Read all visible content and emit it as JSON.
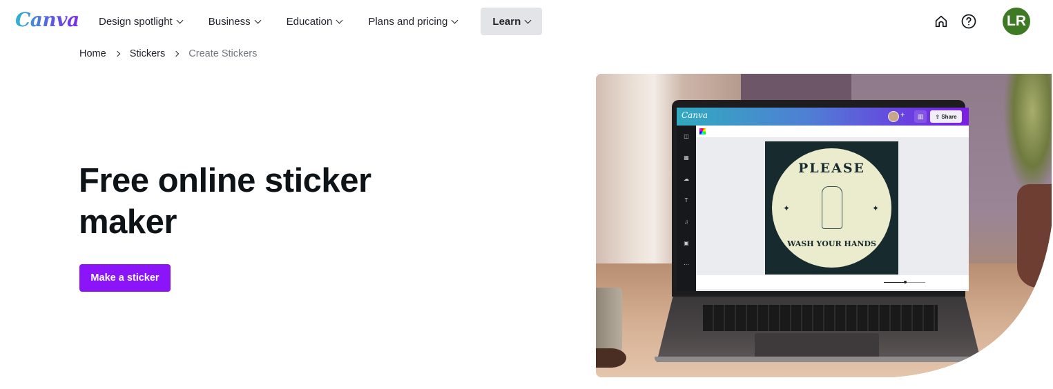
{
  "nav": {
    "logo": "Canva",
    "items": [
      {
        "label": "Design spotlight",
        "has_dropdown": true,
        "active": false
      },
      {
        "label": "Business",
        "has_dropdown": true,
        "active": false
      },
      {
        "label": "Education",
        "has_dropdown": true,
        "active": false
      },
      {
        "label": "Plans and pricing",
        "has_dropdown": true,
        "active": false
      },
      {
        "label": "Learn",
        "has_dropdown": true,
        "active": true
      }
    ],
    "icons": {
      "home": "home-icon",
      "help": "help-circle-icon"
    },
    "avatar_initials": "LR",
    "avatar_color": "#3d7a23"
  },
  "breadcrumb": {
    "items": [
      "Home",
      "Stickers"
    ],
    "current": "Create Stickers"
  },
  "hero": {
    "title_line1": "Free online sticker",
    "title_line2": "maker",
    "cta_label": "Make a sticker",
    "cta_color": "#8b14f8"
  },
  "hero_image": {
    "description": "Laptop on desk showing the Canva editor with a sticker design",
    "editor_logo": "Canva",
    "editor_share_label": "Share",
    "editor_plus": "+",
    "sticker_top_text": "PLEASE",
    "sticker_bottom_text": "WASH YOUR HANDS"
  }
}
